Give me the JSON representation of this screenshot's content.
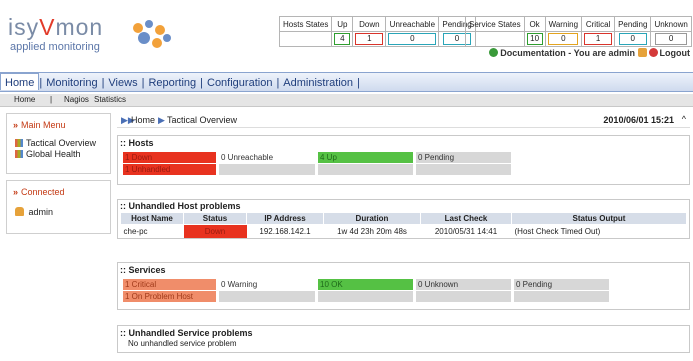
{
  "logo": {
    "text": "isyVmon",
    "tagline": "applied monitoring"
  },
  "host_states": {
    "label": "Hosts States",
    "headers": [
      "Up",
      "Down",
      "Unreachable",
      "Pending"
    ],
    "values": [
      "4",
      "1",
      "0",
      "0"
    ]
  },
  "service_states": {
    "label": "Service States",
    "headers": [
      "Ok",
      "Warning",
      "Critical",
      "Pending",
      "Unknown"
    ],
    "values": [
      "10",
      "0",
      "1",
      "0",
      "0"
    ]
  },
  "header_links": {
    "documentation": "Documentation",
    "you_are": "- You are admin",
    "logout": "Logout"
  },
  "menubar": [
    "Home",
    "Monitoring",
    "Views",
    "Reporting",
    "Configuration",
    "Administration"
  ],
  "subbar": {
    "home": "Home",
    "sep": "|",
    "nagios": "Nagios",
    "statistics": "Statistics"
  },
  "left": {
    "main_menu": {
      "title": "Main Menu",
      "items": [
        "Tactical Overview",
        "Global Health"
      ]
    },
    "connected": {
      "title": "Connected",
      "user": "admin"
    }
  },
  "crumb": {
    "home": "Home",
    "page": "Tactical Overview",
    "datetime": "2010/06/01 15:21"
  },
  "hosts": {
    "title": ":: Hosts",
    "down": "1 Down",
    "unhandled": "1 Unhandled",
    "unreachable": "0 Unreachable",
    "up": "4 Up",
    "pending": "0 Pending"
  },
  "host_problems": {
    "title": ":: Unhandled Host problems",
    "columns": [
      "Host Name",
      "Status",
      "IP Address",
      "Duration",
      "Last Check",
      "Status Output"
    ],
    "rows": [
      [
        "che-pc",
        "Down",
        "192.168.142.1",
        "1w 4d 23h 20m 48s",
        "2010/05/31 14:41",
        "(Host Check Timed Out)"
      ]
    ]
  },
  "services": {
    "title": ":: Services",
    "critical": "1 Critical",
    "on_problem_host": "1 On Problem Host",
    "warning": "0 Warning",
    "ok": "10 OK",
    "unknown": "0 Unknown",
    "pending": "0 Pending"
  },
  "service_problems": {
    "title": ":: Unhandled Service problems",
    "message": "No unhandled service problem"
  },
  "colors": {
    "down": "#e8321f",
    "up": "#55c144",
    "critical": "#f08d6a",
    "menubar_text": "#1f3e7c"
  }
}
